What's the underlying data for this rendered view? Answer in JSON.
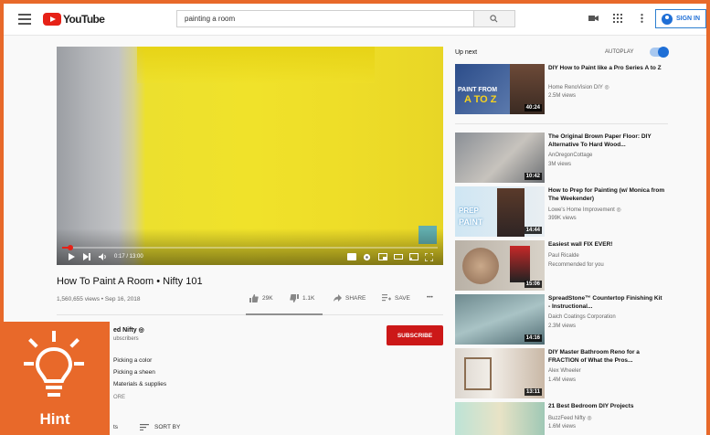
{
  "header": {
    "logo_text": "YouTube",
    "search_value": "painting a room",
    "signin_label": "SIGN IN"
  },
  "player": {
    "time": "0:17 / 13:00",
    "progress_fraction": 0.022
  },
  "video": {
    "title": "How To Paint A Room • Nifty 101",
    "meta": "1,560,655 views • Sep 16, 2018",
    "likes": "29K",
    "dislikes": "1.1K",
    "share_label": "SHARE",
    "save_label": "SAVE",
    "more_label": "•••"
  },
  "channel": {
    "name": "ed Nifty ◎",
    "subs": "ubscribers",
    "subscribe_label": "SUBSCRIBE",
    "desc_lines": [
      "Picking a color",
      "Picking a sheen",
      "Materials & supplies"
    ],
    "show_more": "ORE",
    "comments_label": "ts",
    "sort_label": "SORT BY"
  },
  "sidebar": {
    "up_next": "Up next",
    "autoplay": "AUTOPLAY",
    "items": [
      {
        "title": "DIY How to Paint like a Pro Series A to Z",
        "channel": "Home RenoVision DIY ◎",
        "views": "2.5M views",
        "duration": "40:24",
        "thumb_text_1": "PAINT FROM",
        "thumb_text_2": "A TO Z"
      },
      {
        "title": "The Original Brown Paper Floor: DIY Alternative To Hard Wood...",
        "channel": "AnOregonCottage",
        "views": "3M views",
        "duration": "10:42"
      },
      {
        "title": "How to Prep for Painting (w/ Monica from The Weekender)",
        "channel": "Lowe's Home Improvement ◎",
        "views": "399K views",
        "duration": "14:44",
        "thumb_text_1": "PREP",
        "thumb_text_2": "PAINT"
      },
      {
        "title": "Easiest wall FIX EVER!",
        "channel": "Paul Ricalde",
        "views": "Recommended for you",
        "duration": "15:06"
      },
      {
        "title": "SpreadStone™ Countertop Finishing Kit - Instructional...",
        "channel": "Daich Coatings Corporation",
        "views": "2.3M views",
        "duration": "14:16"
      },
      {
        "title": "DIY Master Bathroom Reno for a FRACTION of What the Pros...",
        "channel": "Alex Wheeler",
        "views": "1.4M views",
        "duration": "13:11"
      },
      {
        "title": "21 Best Bedroom DIY Projects",
        "channel": "BuzzFeed Nifty ◎",
        "views": "1.6M views",
        "duration": ""
      }
    ]
  },
  "hint": {
    "label": "Hint"
  },
  "colors": {
    "accent": "#e8692a",
    "brand_red": "#e62117",
    "link_blue": "#1f6fd6",
    "paint_yellow": "#f0e22a"
  }
}
